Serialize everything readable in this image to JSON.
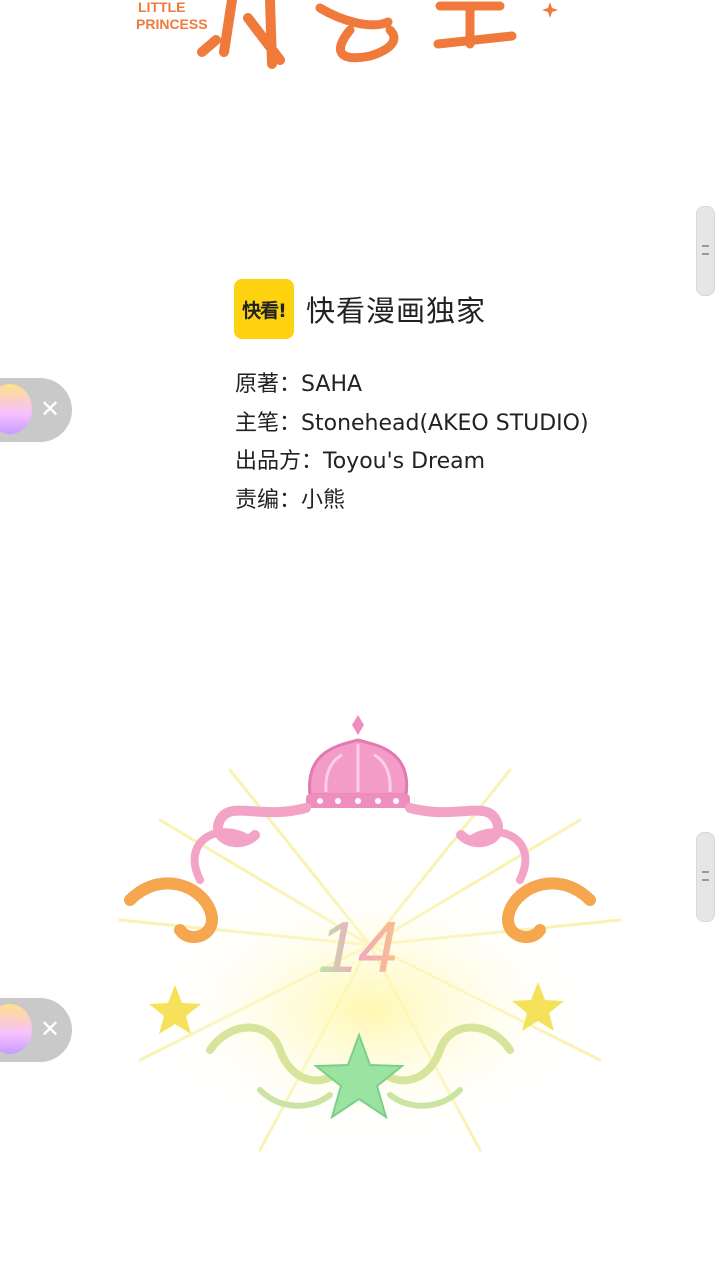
{
  "title_art": {
    "subtitle_line1": "LITTLE",
    "subtitle_line2": "PRINCESS",
    "color": "#f07a3c"
  },
  "brand": {
    "logo_text": "快看!",
    "text": "快看漫画独家",
    "logo_color": "#ffd20f"
  },
  "credits": [
    {
      "label": "原著：",
      "value": "SAHA"
    },
    {
      "label": "主笔：",
      "value": "Stonehead(AKEO STUDIO)"
    },
    {
      "label": "出品方：",
      "value": "Toyou's Dream"
    },
    {
      "label": "责编：",
      "value": "小熊"
    }
  ],
  "chapter": {
    "number": "14",
    "crown_color": "#f08dbf",
    "scroll_orange": "#f5a64f",
    "star_yellow": "#f5e15a",
    "star_green": "#9be3a0"
  },
  "floaters": {
    "icon": "mini-app-thumbnail-icon",
    "close_icon": "close-icon"
  }
}
